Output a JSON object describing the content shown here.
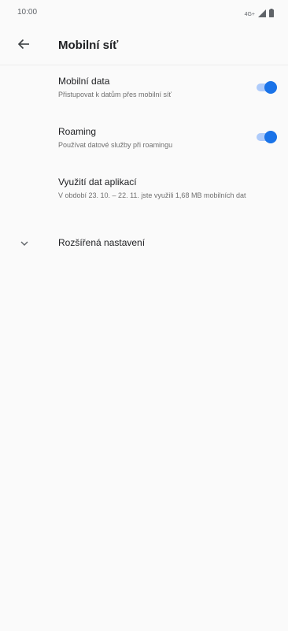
{
  "status_bar": {
    "time": "10:00",
    "network": "4G+",
    "icons": [
      "signal-icon",
      "battery-icon"
    ]
  },
  "app_bar": {
    "back_icon": "arrow-back-icon",
    "title": "Mobilní síť"
  },
  "settings": {
    "mobile_data": {
      "title": "Mobilní data",
      "summary": "Přistupovat k datům přes mobilní síť",
      "enabled": true
    },
    "roaming": {
      "title": "Roaming",
      "summary": "Používat datové služby při roamingu",
      "enabled": true
    },
    "app_data_usage": {
      "title": "Využití dat aplikací",
      "summary": "V období 23. 10. – 22. 11. jste využili 1,68 MB mobilních dat"
    },
    "advanced": {
      "icon": "chevron-down-icon",
      "label": "Rozšířená nastavení"
    }
  },
  "colors": {
    "accent": "#1a73e8",
    "accent_track": "#aecbfa",
    "background": "#fafafa",
    "text_primary": "#202124",
    "text_secondary": "#6f6f6f"
  }
}
